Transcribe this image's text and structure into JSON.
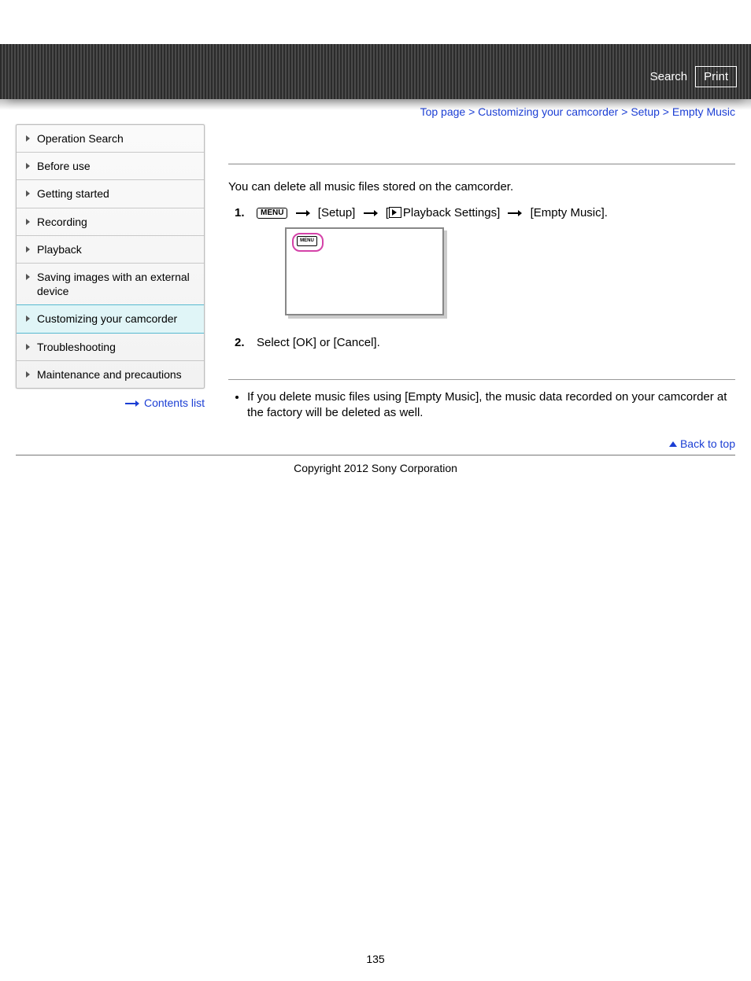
{
  "header": {
    "search_label": "Search",
    "print_label": "Print"
  },
  "breadcrumb": {
    "top": "Top page",
    "customizing": "Customizing your camcorder",
    "setup": "Setup",
    "current": "Empty Music",
    "sep": " > "
  },
  "sidebar": {
    "items": [
      "Operation Search",
      "Before use",
      "Getting started",
      "Recording",
      "Playback",
      "Saving images with an external device",
      "Customizing your camcorder",
      "Troubleshooting",
      "Maintenance and precautions"
    ],
    "contents_link": "Contents list"
  },
  "main": {
    "intro": "You can delete all music files stored on the camcorder.",
    "step1": {
      "menu_label": "MENU",
      "seg1": "[Setup]",
      "seg2_prefix": "[",
      "seg2_text": "Playback Settings]",
      "seg3": "[Empty Music]."
    },
    "figure_badge": "MENU",
    "step2": "Select [OK] or [Cancel].",
    "note1": "If you delete music files using [Empty Music], the music data recorded on your camcorder at the factory will be deleted as well.",
    "back_to_top": "Back to top"
  },
  "footer": {
    "copyright": "Copyright 2012 Sony Corporation",
    "page_number": "135"
  }
}
